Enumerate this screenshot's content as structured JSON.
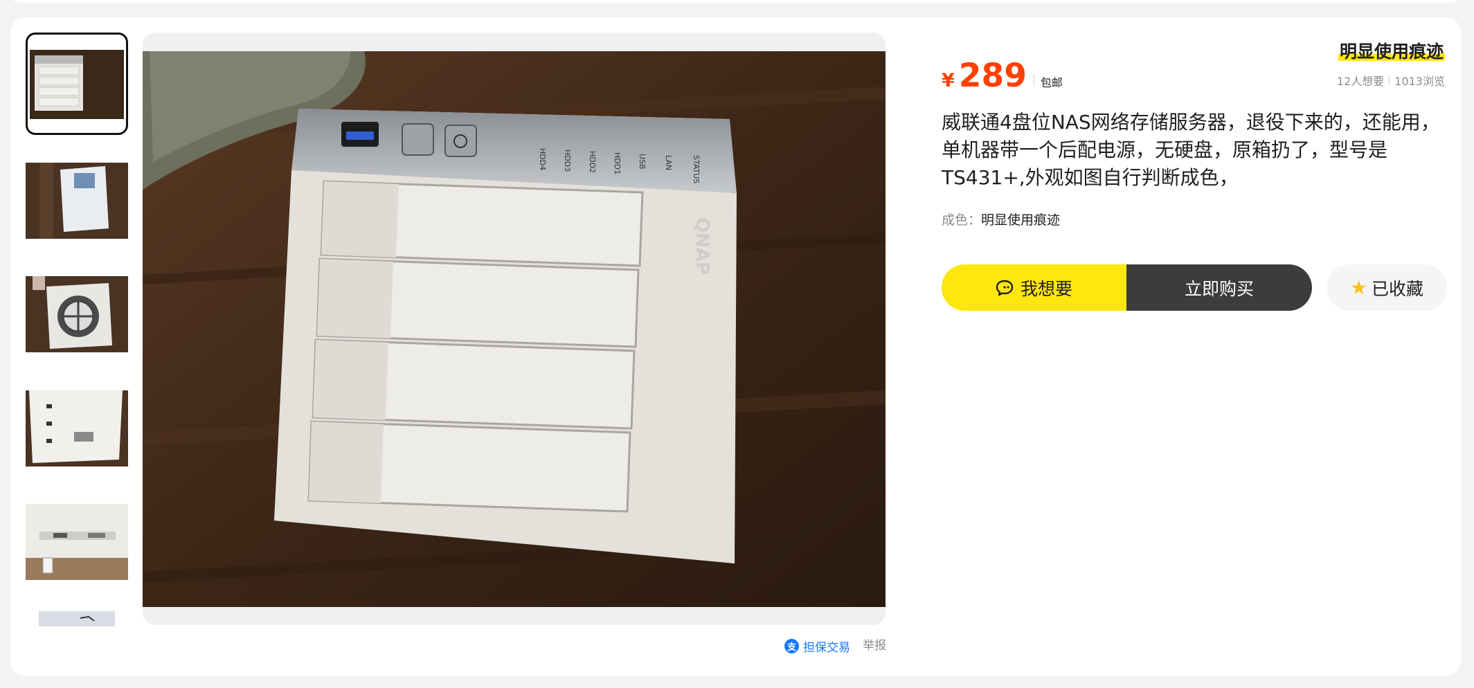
{
  "listing": {
    "condition_tag": "明显使用痕迹",
    "price": {
      "currency_symbol": "¥",
      "amount": "289",
      "shipping": "包邮"
    },
    "stats": {
      "wants": "12人想要",
      "views": "1013浏览"
    },
    "description": "威联通4盘位NAS网络存储服务器，退役下来的，还能用，单机器带一个后配电源，无硬盘，原箱扔了，型号是TS431+,外观如图自行判断成色，",
    "condition": {
      "label": "成色：",
      "value": "明显使用痕迹"
    }
  },
  "actions": {
    "want_label": "我想要",
    "buy_label": "立即购买",
    "favorite_label": "已收藏"
  },
  "footer_links": {
    "guarantee_icon": "支",
    "guarantee": "担保交易",
    "report": "举报"
  },
  "gallery": {
    "selected_index": 0,
    "thumbnail_count": 6
  },
  "product_photo": {
    "device_labels": [
      "HDD4",
      "HDD3",
      "HDD2",
      "HDD1",
      "USB",
      "LAN",
      "STATUS"
    ]
  },
  "icons": {
    "chat": "chat-bubble-icon",
    "star": "star-icon",
    "guarantee": "alipay-guarantee-icon"
  },
  "colors": {
    "price": "#ff4000",
    "want_button": "#ffe60f",
    "buy_button": "#3c3c3c",
    "guarantee_link": "#1677ff",
    "star": "#ffc21a"
  }
}
